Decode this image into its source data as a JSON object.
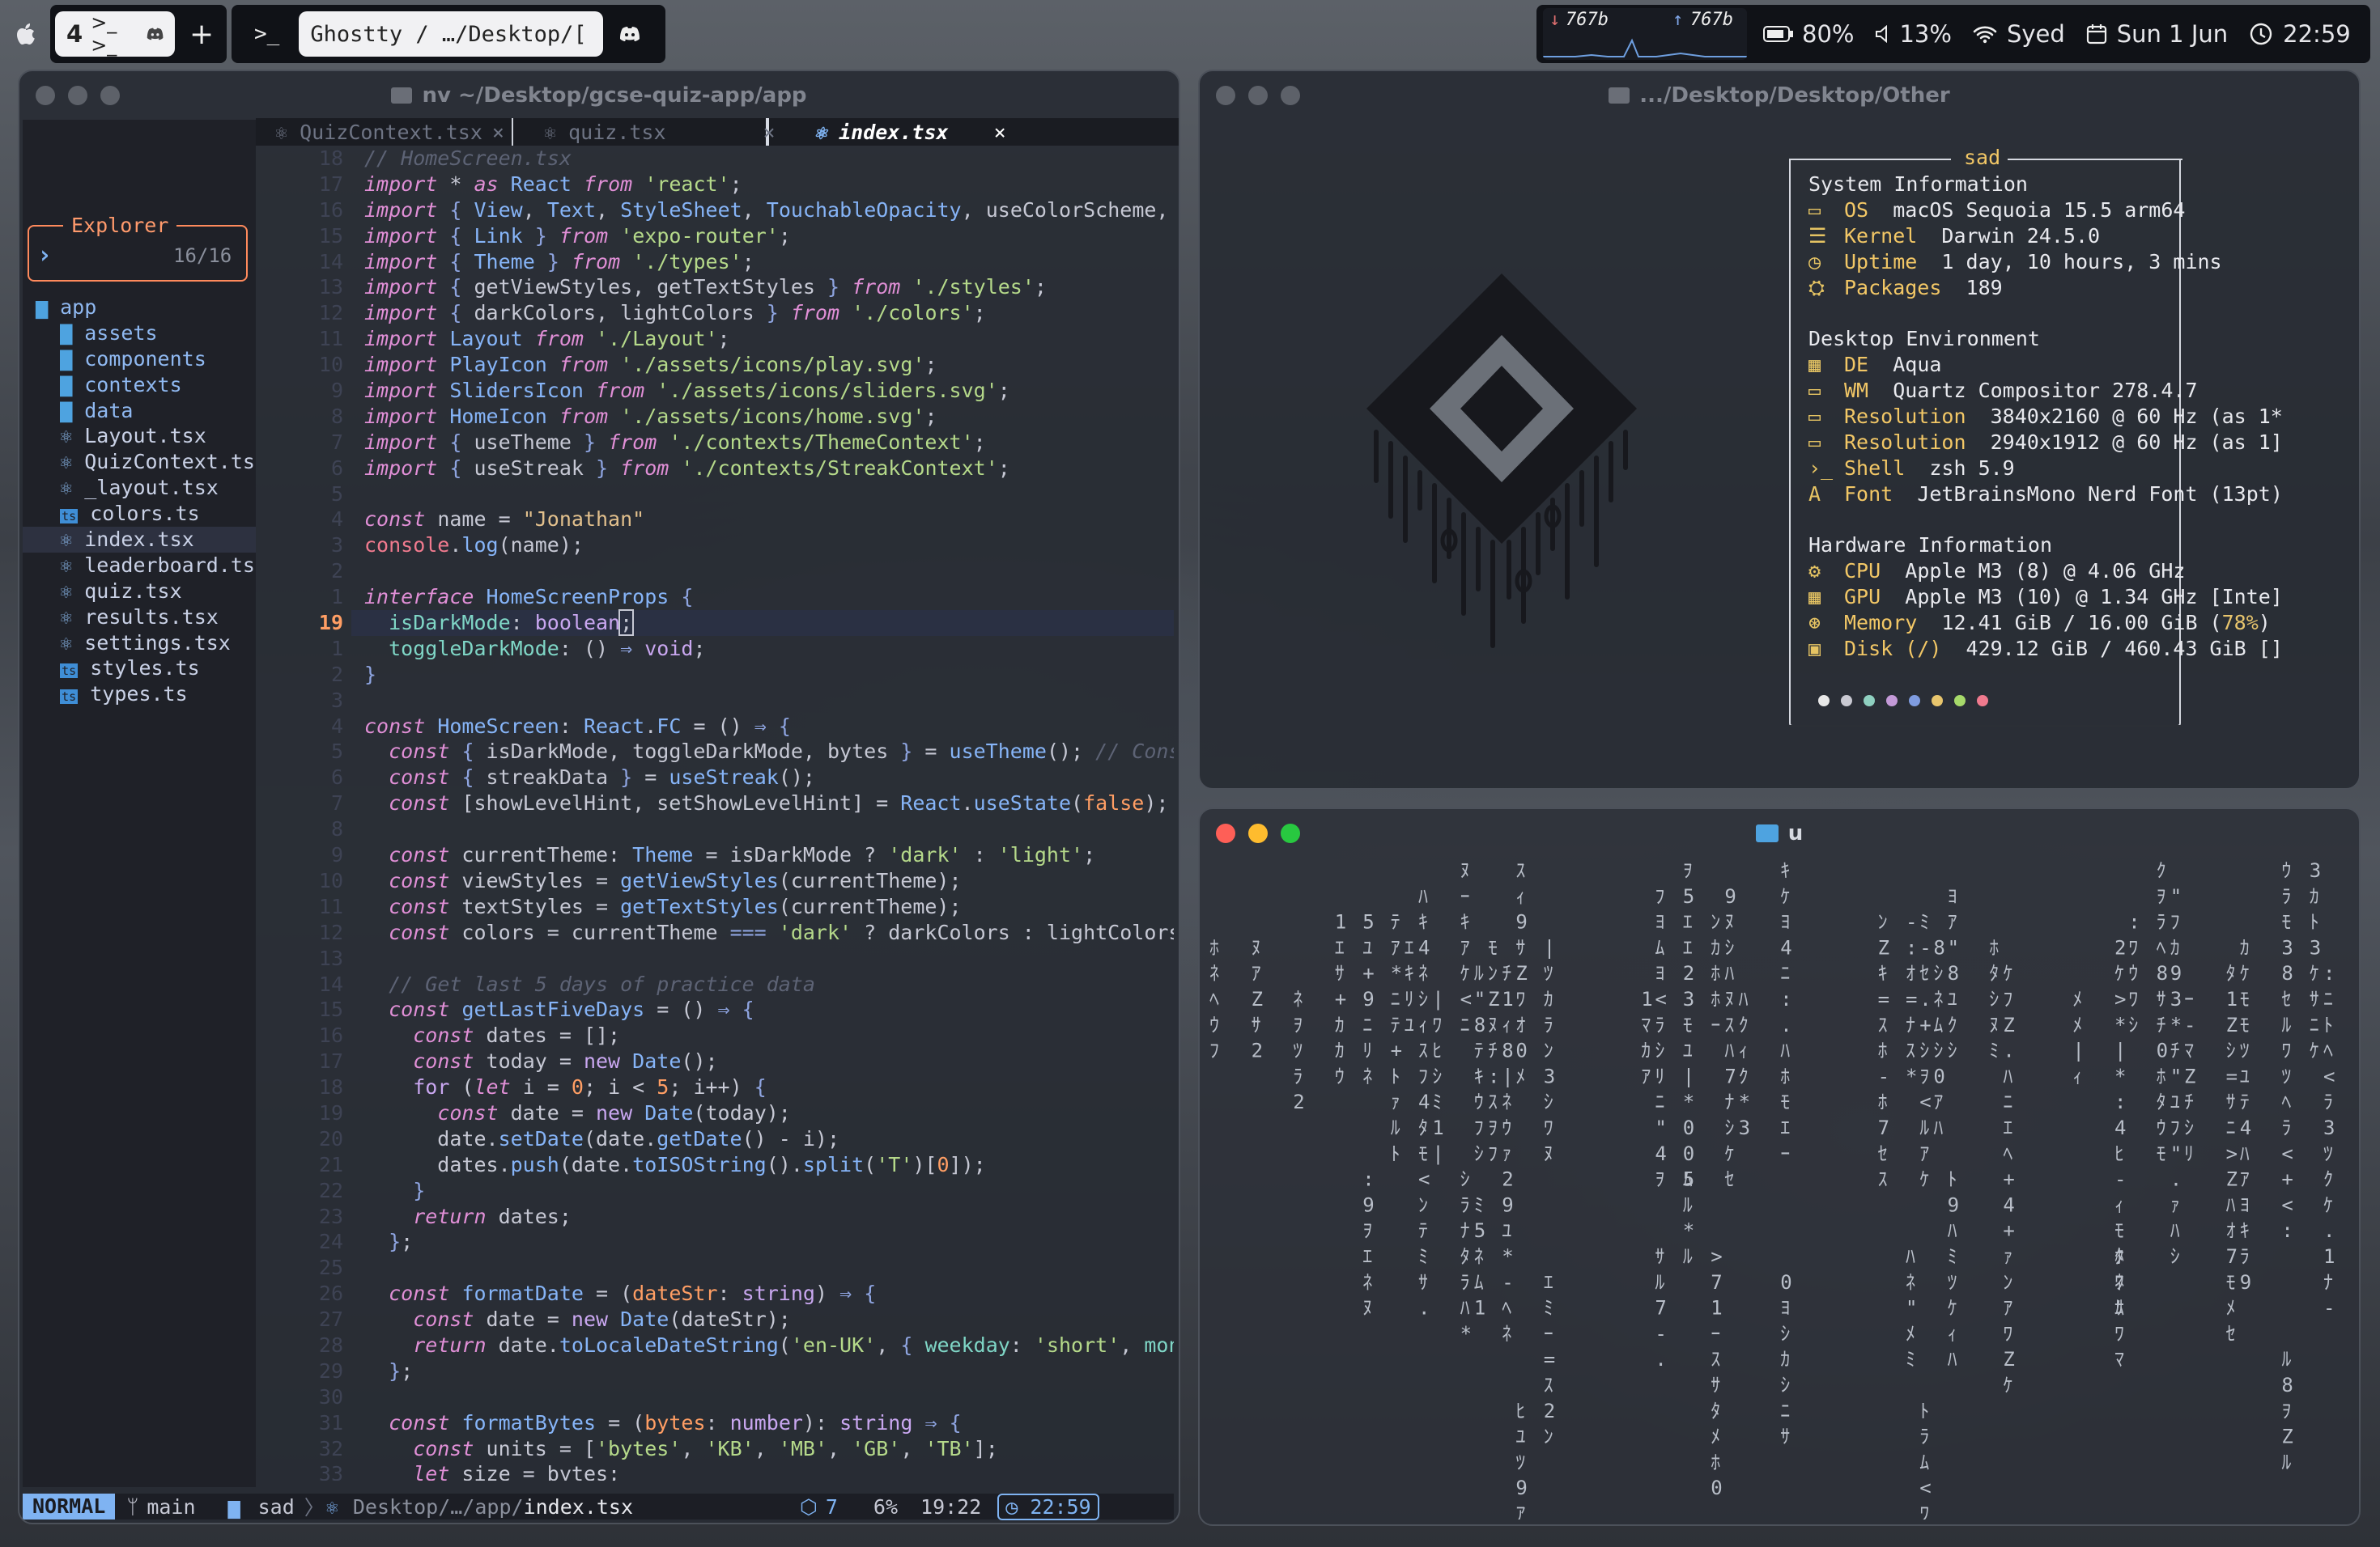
{
  "topbar": {
    "workspace_num": "4",
    "workspace_icons": ">_ >_",
    "add": "+",
    "term_icon": ">_",
    "tab_title": "Ghostty / …/Desktop/[",
    "net_down": "767b",
    "net_up": "767b",
    "battery": "80%",
    "volume": "13%",
    "wifi": "Syed",
    "date": "Sun 1 Jun",
    "time": "22:59"
  },
  "nvim": {
    "title": "nv ~/Desktop/gcse-quiz-app/app",
    "tabs": [
      {
        "label": "QuizContext.tsx",
        "close": "×"
      },
      {
        "label": "quiz.tsx",
        "close": "×"
      },
      {
        "label": "index.tsx",
        "close": "×"
      }
    ],
    "explorer": {
      "title": "Explorer",
      "prompt": "›",
      "count": "16/16",
      "root": "app",
      "items": [
        {
          "icon": "▇",
          "label": "assets",
          "folder": true
        },
        {
          "icon": "▇",
          "label": "components",
          "folder": true
        },
        {
          "icon": "▇",
          "label": "contexts",
          "folder": true
        },
        {
          "icon": "▇",
          "label": "data",
          "folder": true
        },
        {
          "icon": "⚛",
          "label": "Layout.tsx"
        },
        {
          "icon": "⚛",
          "label": "QuizContext.ts"
        },
        {
          "icon": "⚛",
          "label": "_layout.tsx"
        },
        {
          "icon": "ts",
          "label": "colors.ts"
        },
        {
          "icon": "⚛",
          "label": "index.tsx"
        },
        {
          "icon": "⚛",
          "label": "leaderboard.ts"
        },
        {
          "icon": "⚛",
          "label": "quiz.tsx"
        },
        {
          "icon": "⚛",
          "label": "results.tsx"
        },
        {
          "icon": "⚛",
          "label": "settings.tsx"
        },
        {
          "icon": "ts",
          "label": "styles.ts"
        },
        {
          "icon": "ts",
          "label": "types.ts"
        }
      ]
    },
    "line_numbers": [
      "18",
      "17",
      "16",
      "15",
      "14",
      "13",
      "12",
      "11",
      "10",
      "9",
      "8",
      "7",
      "6",
      "5",
      "4",
      "3",
      "2",
      "1",
      "19",
      "1",
      "2",
      "3",
      "4",
      "5",
      "6",
      "7",
      "8",
      "9",
      "10",
      "11",
      "12",
      "13",
      "14",
      "15",
      "16",
      "17",
      "18",
      "19",
      "20",
      "21",
      "22",
      "23",
      "24",
      "25",
      "26",
      "27",
      "28",
      "29",
      "30",
      "31",
      "32",
      "33"
    ],
    "status": {
      "mode": "NORMAL",
      "branch": "main",
      "folder": "sad",
      "path": "Desktop/…/app/",
      "file": "index.tsx",
      "lsp": "7",
      "percent": "6%",
      "pos": "19:22",
      "time": "22:59"
    }
  },
  "fastfetch": {
    "title": ".../Desktop/Desktop/Other",
    "header": "sad",
    "sys_title": "System Information",
    "sys": [
      {
        "icon": "▭",
        "label": "OS",
        "value": "macOS Sequoia 15.5 arm64"
      },
      {
        "icon": "☰",
        "label": "Kernel",
        "value": "Darwin 24.5.0"
      },
      {
        "icon": "◷",
        "label": "Uptime",
        "value": "1 day, 10 hours, 3 mins"
      },
      {
        "icon": "⛭",
        "label": "Packages",
        "value": "189"
      }
    ],
    "de_title": "Desktop Environment",
    "de": [
      {
        "icon": "▦",
        "label": "DE",
        "value": "Aqua"
      },
      {
        "icon": "▭",
        "label": "WM",
        "value": "Quartz Compositor 278.4.7"
      },
      {
        "icon": "▭",
        "label": "Resolution",
        "value": "3840x2160 @ 60 Hz (as 1*"
      },
      {
        "icon": "▭",
        "label": "Resolution",
        "value": "2940x1912 @ 60 Hz (as 1]"
      },
      {
        "icon": "›_",
        "label": "Shell",
        "value": "zsh 5.9"
      },
      {
        "icon": "A",
        "label": "Font",
        "value": "JetBrainsMono Nerd Font (13pt)"
      }
    ],
    "hw_title": "Hardware Information",
    "hw": [
      {
        "icon": "⚙",
        "label": "CPU",
        "value": "Apple M3 (8) @ 4.06 GHz"
      },
      {
        "icon": "▦",
        "label": "GPU",
        "value": "Apple M3 (10) @ 1.34 GHz [Inte]"
      },
      {
        "icon": "⊛",
        "label": "Memory",
        "value": "12.41 GiB / 16.00 GiB (",
        "pct": "78%",
        "tail": ")"
      },
      {
        "icon": "▣",
        "label": "Disk (/)",
        "value": "429.12 GiB / 460.43 GiB []"
      }
    ],
    "dots": [
      "#e8e8e8",
      "#c9c9d2",
      "#8fd0c0",
      "#c49ad8",
      "#7f9ce0",
      "#e8c56d",
      "#a6d96a",
      "#f07a8e"
    ]
  },
  "matrix": {
    "title": "u"
  }
}
